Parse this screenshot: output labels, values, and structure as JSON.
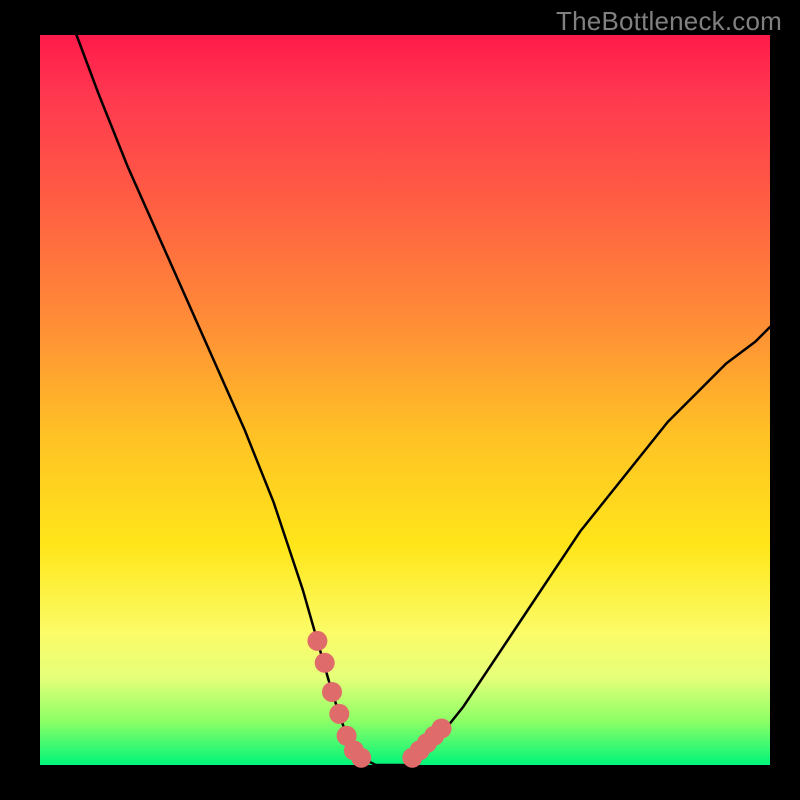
{
  "watermark": "TheBottleneck.com",
  "chart_data": {
    "type": "line",
    "title": "",
    "xlabel": "",
    "ylabel": "",
    "xlim": [
      0,
      100
    ],
    "ylim": [
      0,
      100
    ],
    "series": [
      {
        "name": "curve",
        "x": [
          5,
          8,
          12,
          16,
          20,
          24,
          28,
          32,
          34,
          36,
          38,
          40,
          42,
          44,
          46,
          48,
          50,
          54,
          58,
          62,
          66,
          70,
          74,
          78,
          82,
          86,
          90,
          94,
          98,
          100
        ],
        "y": [
          100,
          92,
          82,
          73,
          64,
          55,
          46,
          36,
          30,
          24,
          17,
          10,
          4,
          1,
          0,
          0,
          0,
          3,
          8,
          14,
          20,
          26,
          32,
          37,
          42,
          47,
          51,
          55,
          58,
          60
        ]
      },
      {
        "name": "markers",
        "x": [
          38,
          39,
          40,
          41,
          42,
          43,
          44,
          51,
          52,
          53,
          54,
          55
        ],
        "y": [
          17,
          14,
          10,
          7,
          4,
          2,
          1,
          1,
          2,
          3,
          4,
          5
        ]
      }
    ]
  },
  "colors": {
    "curve_stroke": "#000000",
    "marker_fill": "#e06b6b"
  }
}
